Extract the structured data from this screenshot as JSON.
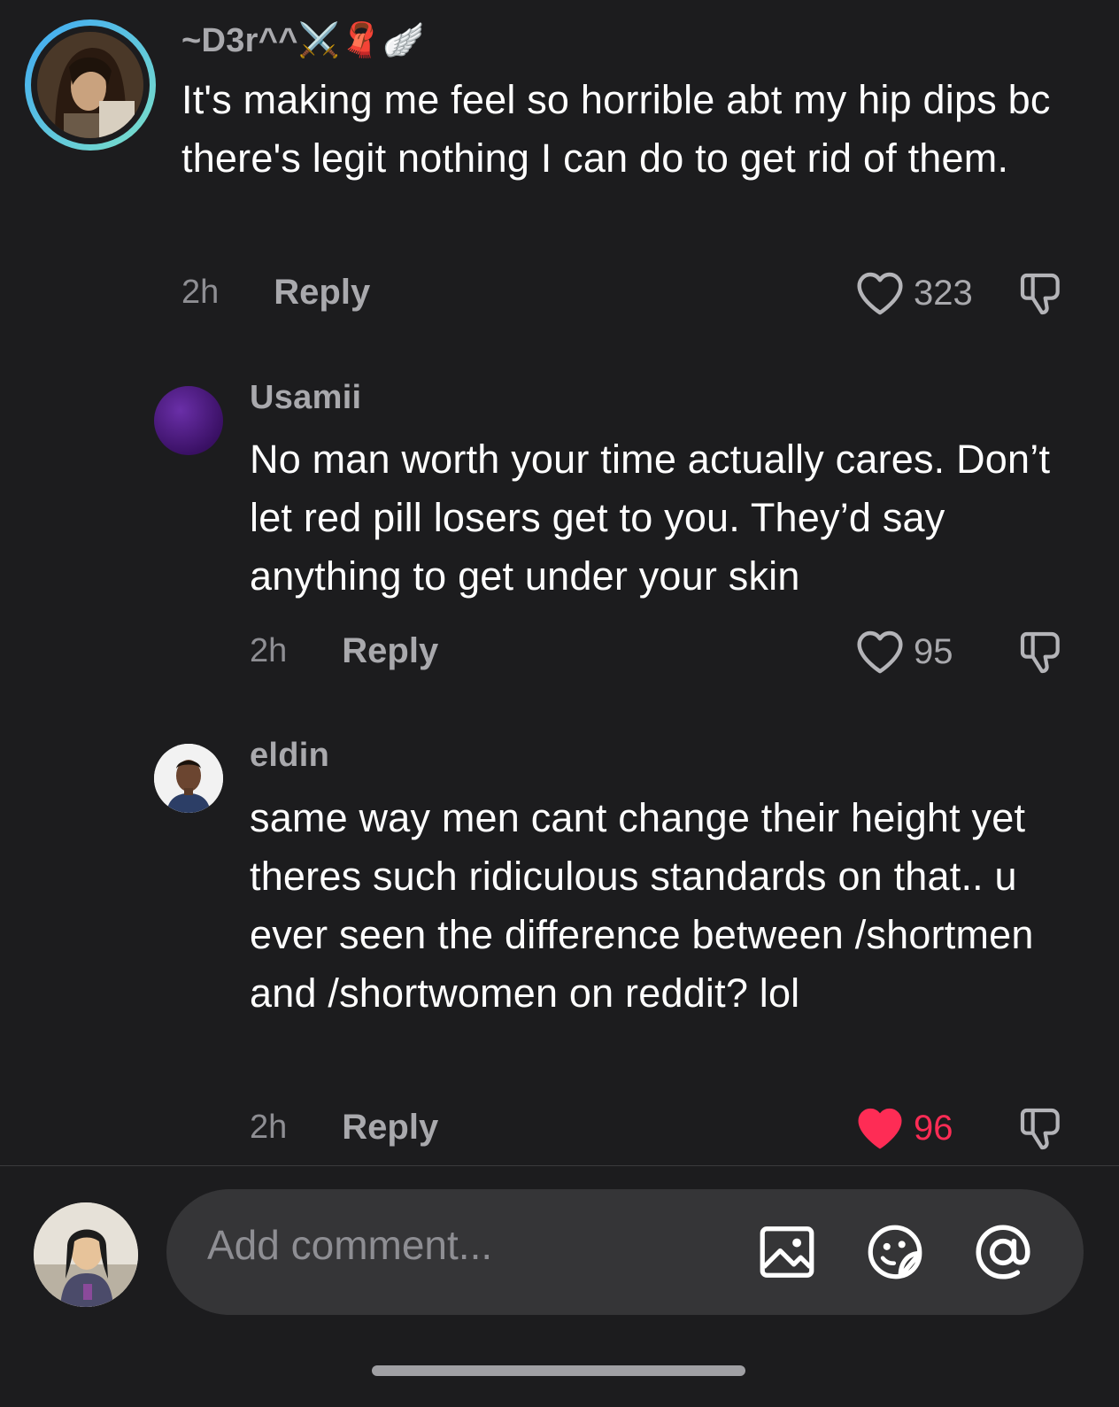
{
  "comments": [
    {
      "username": "~D3r^^⚔️🧣🪽",
      "text": "It's making me feel so horrible abt my hip dips bc there's legit nothing I can do to get rid of them.",
      "time": "2h",
      "reply_label": "Reply",
      "likes": "323",
      "liked": false
    },
    {
      "username": "Usamii",
      "text": "No man worth your time actually cares. Don’t let red pill losers get to you. They’d say anything to get under your skin",
      "time": "2h",
      "reply_label": "Reply",
      "likes": "95",
      "liked": false
    },
    {
      "username": "eldin",
      "text": "same way men cant change their height yet theres such ridiculous standards on that.. u ever seen the difference between /shortmen and /shortwomen on reddit? lol",
      "time": "2h",
      "reply_label": "Reply",
      "likes": "96",
      "liked": true
    }
  ],
  "composer": {
    "placeholder": "Add comment..."
  },
  "colors": {
    "background": "#1c1c1e",
    "liked": "#fe2c55",
    "muted": "#a9a9ad",
    "composer_bg": "#353537",
    "story_ring_start": "#3fa9f5",
    "story_ring_end": "#7be0c8"
  },
  "icons": {
    "like": "heart-outline-icon",
    "liked": "heart-filled-icon",
    "dislike": "thumbs-down-icon",
    "image": "image-icon",
    "sticker": "sticker-icon",
    "mention": "at-sign-icon"
  }
}
